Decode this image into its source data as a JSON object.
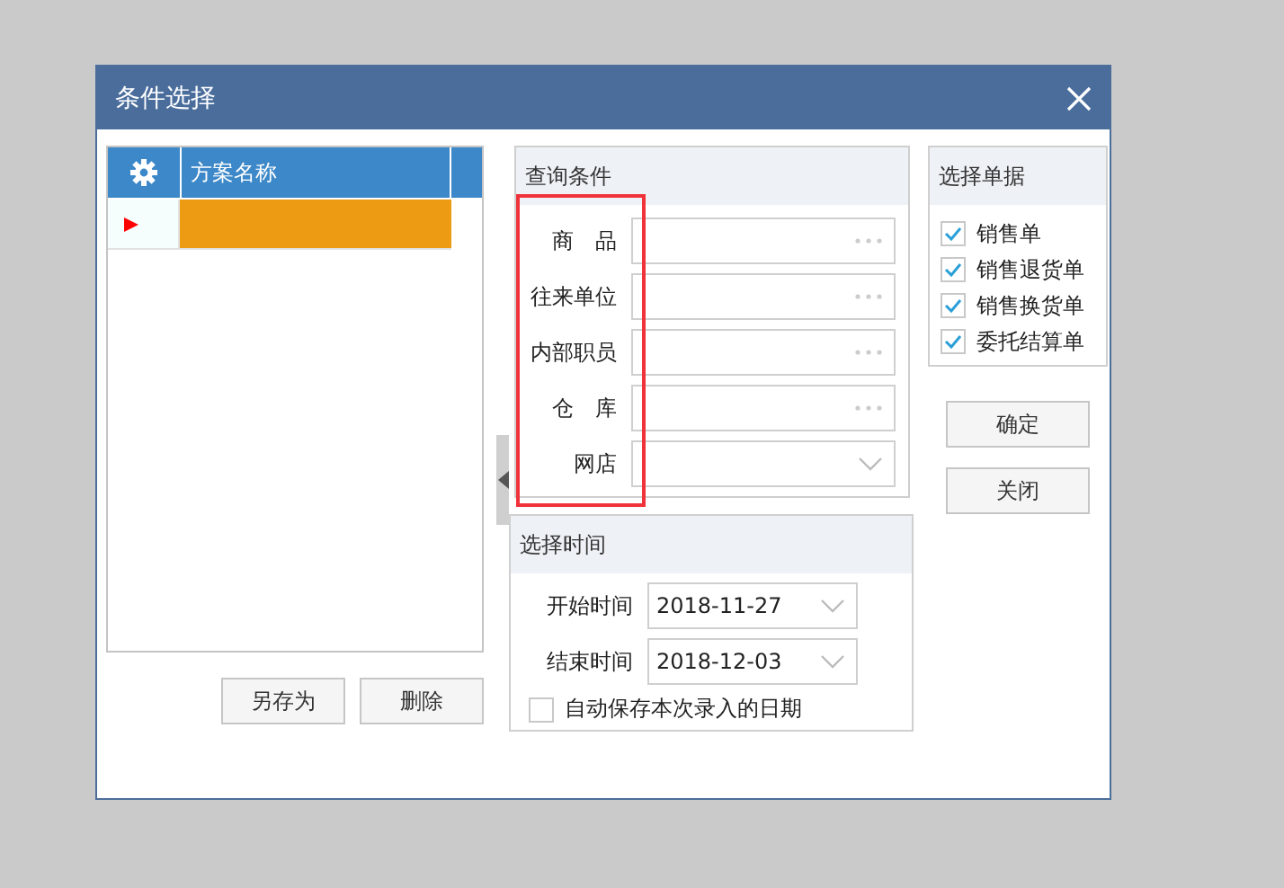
{
  "window": {
    "title": "条件选择"
  },
  "scheme_table": {
    "header": "方案名称",
    "rows": [
      {
        "name": "",
        "selected": true
      }
    ]
  },
  "scheme_buttons": [
    "另存为",
    "删除"
  ],
  "query": {
    "title": "查询条件",
    "fields": [
      {
        "label": "商　品",
        "kind": "picker"
      },
      {
        "label": "往来单位",
        "kind": "picker"
      },
      {
        "label": "内部职员",
        "kind": "picker"
      },
      {
        "label": "仓　库",
        "kind": "picker"
      },
      {
        "label": "网店",
        "kind": "dropdown"
      }
    ]
  },
  "time": {
    "title": "选择时间",
    "rows": [
      {
        "label": "开始时间",
        "value": "2018-11-27"
      },
      {
        "label": "结束时间",
        "value": "2018-12-03"
      }
    ],
    "remember": {
      "label": "自动保存本次录入的日期",
      "checked": false
    }
  },
  "bills": {
    "title": "选择单据",
    "items": [
      {
        "label": "销售单",
        "checked": true
      },
      {
        "label": "销售退货单",
        "checked": true
      },
      {
        "label": "销售换货单",
        "checked": true
      },
      {
        "label": "委托结算单",
        "checked": true
      }
    ]
  },
  "buttons": [
    "确定",
    "关闭"
  ]
}
